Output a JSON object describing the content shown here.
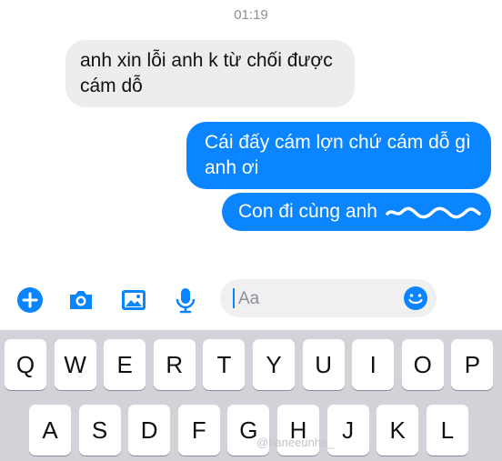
{
  "status": {
    "time": "01:19"
  },
  "messages": [
    {
      "side": "incoming",
      "line1": "anh xin lỗi anh k từ chối được",
      "line2": "cám dỗ"
    },
    {
      "side": "outgoing",
      "line1": "Cái đấy cám lợn chứ cám dỗ gì",
      "line2": "anh ơi"
    },
    {
      "side": "outgoing",
      "text": "Con đi cùng anh"
    }
  ],
  "composer": {
    "placeholder": "Aa"
  },
  "toolbar_icons": [
    "plus-circle-icon",
    "camera-icon",
    "image-icon",
    "microphone-icon",
    "emoji-icon"
  ],
  "keyboard": {
    "row1": [
      "Q",
      "W",
      "E",
      "R",
      "T",
      "Y",
      "U",
      "I",
      "O",
      "P"
    ],
    "row2": [
      "A",
      "S",
      "D",
      "F",
      "G",
      "H",
      "J",
      "K",
      "L"
    ]
  },
  "watermark": "@haneeunhe_",
  "colors": {
    "accent": "#0a84ff",
    "incoming_bubble": "#ededef",
    "keyboard_bg": "#d1d3d9"
  }
}
